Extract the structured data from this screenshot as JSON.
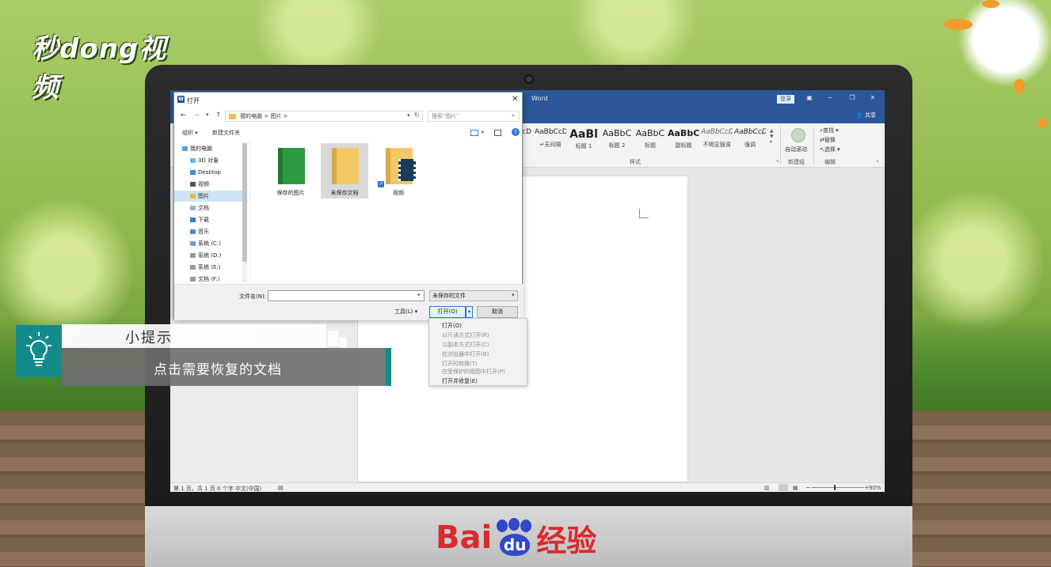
{
  "brand": {
    "logo_text": "秒dong视频",
    "footer_brand_latin": "Bai",
    "footer_brand_du": "du",
    "footer_brand_cn": "经验"
  },
  "word": {
    "title": "Word",
    "login": "登录",
    "share": "共享",
    "styles": [
      {
        "sample": "AaBbCcDt",
        "label": "↵无间隔"
      },
      {
        "sample": "AaBl",
        "label": "标题 1"
      },
      {
        "sample": "AaBbC",
        "label": "标题 2"
      },
      {
        "sample": "AaBbC",
        "label": "标题"
      },
      {
        "sample": "AaBbC",
        "label": "副标题"
      },
      {
        "sample": "AaBbCcDt",
        "label": "不明显强调"
      },
      {
        "sample": "AaBbCcDt",
        "label": "强调"
      }
    ],
    "style_cut": "cDt",
    "group_styles": "样式",
    "group_new": "新建组",
    "group_edit": "编辑",
    "autoscroll_label": "自动滚动",
    "edit_find": "查找",
    "edit_replace": "替换",
    "edit_select": "选择",
    "status": "第 1 页，共 1 页    0 个字    中文(中国)",
    "zoom": "90%"
  },
  "dialog": {
    "title": "打开",
    "path": "我的电脑  >  图片  >",
    "search_placeholder": "搜索\"图片\"",
    "organize": "组织 ▾",
    "new_folder": "新建文件夹",
    "sidebar": [
      {
        "label": "我的电脑",
        "selected": false
      },
      {
        "label": "3D 对象",
        "selected": false
      },
      {
        "label": "Desktop",
        "selected": false
      },
      {
        "label": "视频",
        "selected": false
      },
      {
        "label": "图片",
        "selected": true
      },
      {
        "label": "文档",
        "selected": false
      },
      {
        "label": "下载",
        "selected": false
      },
      {
        "label": "音乐",
        "selected": false
      },
      {
        "label": "系统 (C:)",
        "selected": false
      },
      {
        "label": "系统 (D:)",
        "selected": false
      },
      {
        "label": "系统 (E:)",
        "selected": false
      },
      {
        "label": "文档 (F:)",
        "selected": false
      }
    ],
    "files": [
      {
        "name": "保存的图片"
      },
      {
        "name": "未保存文档"
      },
      {
        "name": "视频"
      }
    ],
    "filename_label": "文件名(N):",
    "filename_value": "",
    "filetype_value": "未保存的文件",
    "tools": "工具(L)  ▾",
    "open_button": "打开(O)",
    "cancel_button": "取消"
  },
  "open_menu": [
    {
      "label": "打开(O)",
      "enabled": true
    },
    {
      "label": "以只读方式打开(R)",
      "enabled": false
    },
    {
      "label": "以副本方式打开(C)",
      "enabled": false
    },
    {
      "label": "在浏览器中打开(B)",
      "enabled": false
    },
    {
      "label": "打开时转换(T)",
      "enabled": false
    },
    {
      "label": "在受保护的视图中打开(P)",
      "enabled": false
    },
    {
      "label": "打开并修复(E)",
      "enabled": true
    }
  ],
  "tip": {
    "title": "小提示",
    "text": "点击需要恢复的文档"
  },
  "colors": {
    "word_blue": "#2b579a",
    "tip_teal": "#138b8b"
  }
}
